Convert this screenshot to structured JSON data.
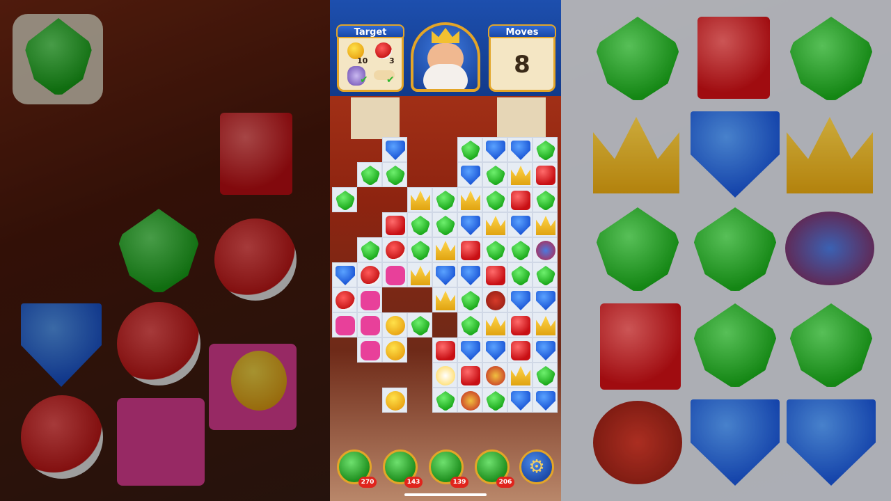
{
  "header": {
    "target_label": "Target",
    "moves_label": "Moves",
    "moves_value": "8",
    "targets": [
      {
        "item": "duck-icon",
        "count": "10"
      },
      {
        "item": "bird-icon",
        "count": "3"
      },
      {
        "item": "vase-icon",
        "done": true
      },
      {
        "item": "bone-icon",
        "done": true
      }
    ]
  },
  "boosters": [
    {
      "name": "hammer-booster",
      "count": "270"
    },
    {
      "name": "arrow-booster",
      "count": "143"
    },
    {
      "name": "cannon-booster",
      "count": "139"
    },
    {
      "name": "jester-booster",
      "count": "206"
    }
  ],
  "board_rows": [
    "....SS....",
    "...L.L....",
    ".L..SLSL..",
    "........",
    "........"
  ],
  "colors": {
    "leaf": "#19a819",
    "shield": "#1b56d6",
    "crown": "#e0a310",
    "box": "#c80f14",
    "frame": "#e3a528"
  }
}
